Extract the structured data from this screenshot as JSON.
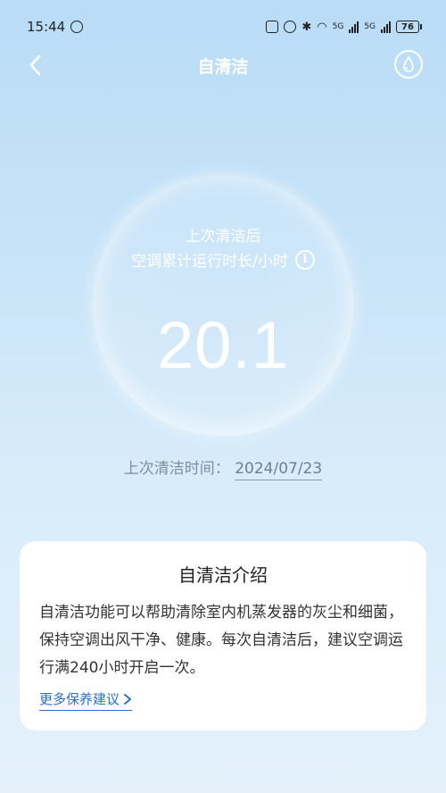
{
  "status_bar": {
    "time": "15:44",
    "signal_1": "5G",
    "signal_2": "5G",
    "battery": "76"
  },
  "nav": {
    "title": "自清洁"
  },
  "bubble": {
    "line1": "上次清洁后",
    "line2": "空调累计运行时长/小时",
    "value": "20.1"
  },
  "last_clean": {
    "label": "上次清洁时间：",
    "date": "2024/07/23"
  },
  "card": {
    "title": "自清洁介绍",
    "body": "自清洁功能可以帮助清除室内机蒸发器的灰尘和细菌，保持空调出风干净、健康。每次自清洁后，建议空调运行满240小时开启一次。",
    "link": "更多保养建议"
  },
  "colors": {
    "background_top": "#b9dcf7",
    "background_bottom": "#e4f1fb",
    "link": "#2b6fd0"
  }
}
